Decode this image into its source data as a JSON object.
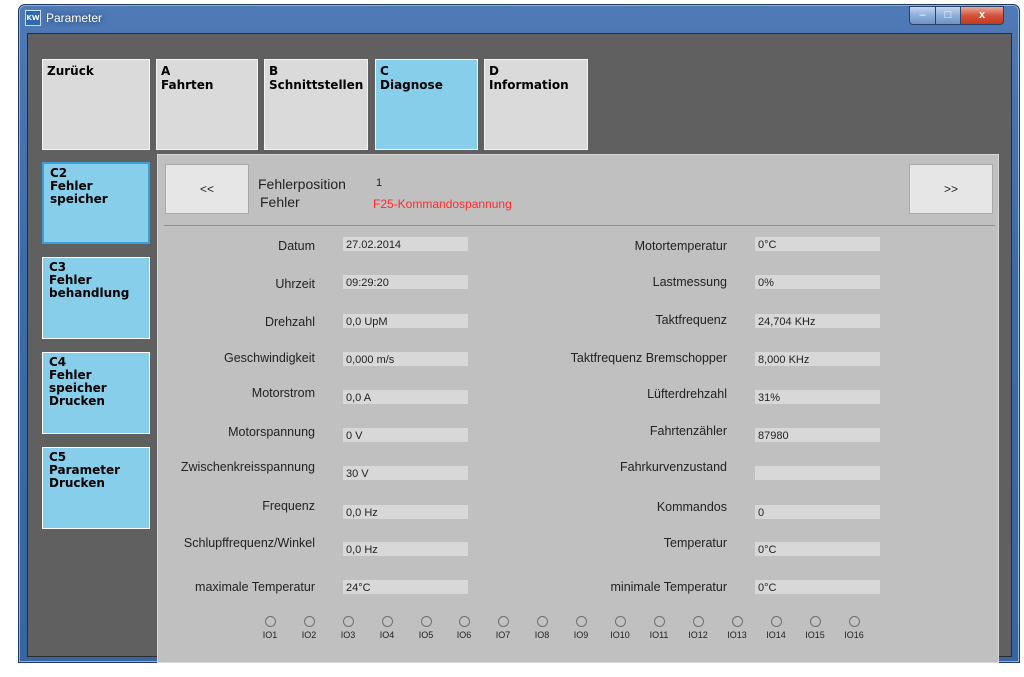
{
  "window": {
    "title": "Parameter",
    "icon": "app-icon",
    "controls": {
      "minimize": "–",
      "maximize": "□",
      "close": "x"
    }
  },
  "tabs": [
    {
      "code": "",
      "label": "Zurück",
      "active": false
    },
    {
      "code": "A",
      "label": "Fahrten",
      "active": false
    },
    {
      "code": "B",
      "label": "Schnittstellen",
      "active": false
    },
    {
      "code": "C",
      "label": "Diagnose",
      "active": true
    },
    {
      "code": "D",
      "label": "Information",
      "active": false
    }
  ],
  "sidebar": [
    {
      "code": "C2",
      "lines": [
        "Fehler",
        "speicher"
      ],
      "active": true
    },
    {
      "code": "C3",
      "lines": [
        "Fehler",
        "behandlung"
      ],
      "active": false
    },
    {
      "code": "C4",
      "lines": [
        "Fehler",
        "speicher",
        "Drucken"
      ],
      "active": false
    },
    {
      "code": "C5",
      "lines": [
        "Parameter",
        "Drucken"
      ],
      "active": false
    }
  ],
  "header": {
    "prev_label": "<<",
    "next_label": ">>",
    "error_position_label": "Fehlerposition",
    "error_position_value": "1",
    "error_label": "Fehler",
    "error_value": "F25-Kommandospannung"
  },
  "fields_left": [
    {
      "label": "Datum",
      "value": "27.02.2014"
    },
    {
      "label": "Uhrzeit",
      "value": "09:29:20"
    },
    {
      "label": "Drehzahl",
      "value": "0,0 UpM"
    },
    {
      "label": "Geschwindigkeit",
      "value": "0,000 m/s"
    },
    {
      "label": "Motorstrom",
      "value": "0,0 A"
    },
    {
      "label": "Motorspannung",
      "value": "0 V"
    },
    {
      "label": "Zwischenkreisspannung",
      "value": "30 V"
    },
    {
      "label": "Frequenz",
      "value": "0,0 Hz"
    },
    {
      "label": "Schlupffrequenz/Winkel",
      "value": "0,0 Hz"
    },
    {
      "label": "maximale Temperatur",
      "value": "24°C"
    }
  ],
  "fields_right": [
    {
      "label": "Motortemperatur",
      "value": "0°C"
    },
    {
      "label": "Lastmessung",
      "value": "0%"
    },
    {
      "label": "Taktfrequenz",
      "value": "24,704 KHz"
    },
    {
      "label": "Taktfrequenz Bremschopper",
      "value": "8,000 KHz"
    },
    {
      "label": "Lüfterdrehzahl",
      "value": "31%"
    },
    {
      "label": "Fahrtenzähler",
      "value": "87980"
    },
    {
      "label": "Fahrkurvenzustand",
      "value": ""
    },
    {
      "label": "Kommandos",
      "value": "0"
    },
    {
      "label": "Temperatur",
      "value": "0°C"
    },
    {
      "label": "minimale Temperatur",
      "value": "0°C"
    }
  ],
  "io_labels": [
    "IO1",
    "IO2",
    "IO3",
    "IO4",
    "IO5",
    "IO6",
    "IO7",
    "IO8",
    "IO9",
    "IO10",
    "IO11",
    "IO12",
    "IO13",
    "IO14",
    "IO15",
    "IO16"
  ],
  "colors": {
    "accent": "#87ceeb",
    "error": "#ff2b2b",
    "panel": "#c0c0c0",
    "background": "#606060"
  }
}
